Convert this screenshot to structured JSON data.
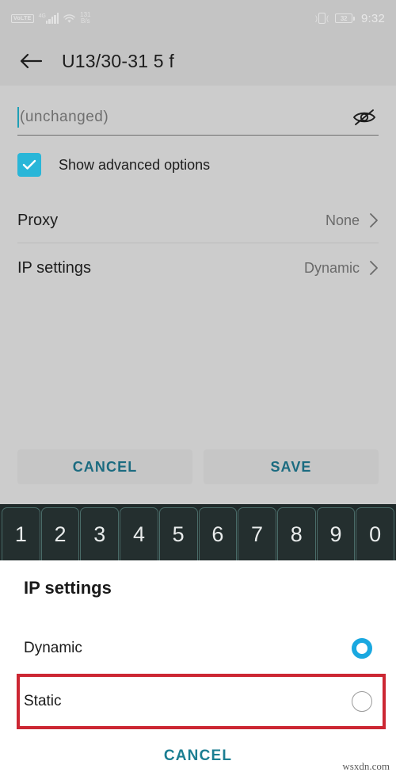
{
  "status_bar": {
    "volte_badge": "VoLTE",
    "network_type": "4G",
    "wifi_icon": "wifi-icon",
    "net_speed_value": "131",
    "net_speed_unit": "B/s",
    "vibrate_icon": "vibrate-icon",
    "battery_level": "32",
    "time": "9:32"
  },
  "header": {
    "back_icon": "back-arrow-icon",
    "title": "U13/30-31 5 f"
  },
  "form": {
    "password_placeholder": "(unchanged)",
    "password_value": "",
    "toggle_visibility_icon": "eye-off-icon",
    "advanced_checkbox_label": "Show advanced options",
    "advanced_checkbox_checked": true,
    "rows": [
      {
        "label": "Proxy",
        "value": "None",
        "chevron": "chevron-right-icon"
      },
      {
        "label": "IP settings",
        "value": "Dynamic",
        "chevron": "chevron-right-icon"
      }
    ],
    "cancel_label": "CANCEL",
    "save_label": "SAVE"
  },
  "keyboard": {
    "keys": [
      "1",
      "2",
      "3",
      "4",
      "5",
      "6",
      "7",
      "8",
      "9",
      "0"
    ]
  },
  "sheet": {
    "title": "IP settings",
    "options": [
      {
        "label": "Dynamic",
        "selected": true
      },
      {
        "label": "Static",
        "selected": false
      }
    ],
    "cancel_label": "CANCEL",
    "highlight_color": "#cc2733"
  },
  "watermark": "wsxdn.com",
  "colors": {
    "background": "#cccccc",
    "statusbar": "#c4c4c4",
    "accent_teal": "#1b6b80",
    "checkbox_cyan": "#29b6d8",
    "radio_blue": "#1aa8e0",
    "keyboard_dark": "#242f2f",
    "key_border": "#4a6b68",
    "highlight_red": "#cc2733"
  }
}
